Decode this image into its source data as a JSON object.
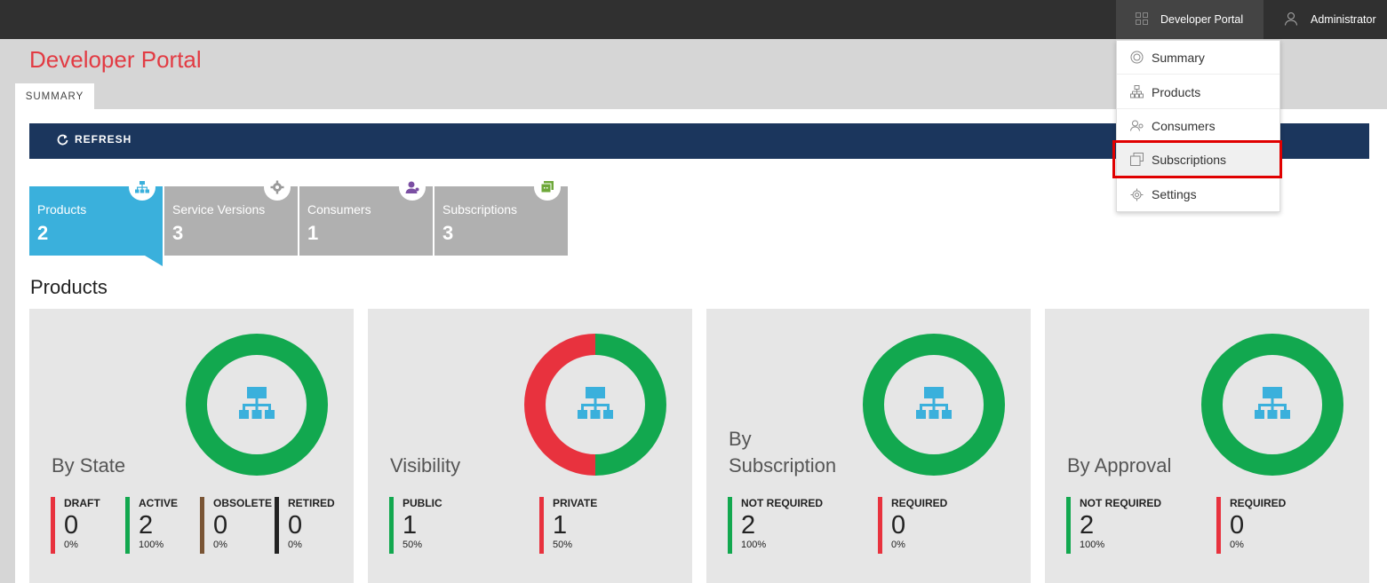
{
  "topbar": {
    "portal_label": "Developer Portal",
    "user_label": "Administrator"
  },
  "page": {
    "title": "Developer Portal",
    "tab": "SUMMARY",
    "refresh_label": "REFRESH",
    "section_title": "Products"
  },
  "tiles": [
    {
      "label": "Products",
      "count": "2",
      "icon": "hierarchy-icon",
      "active": true
    },
    {
      "label": "Service Versions",
      "count": "3",
      "icon": "gear-icon",
      "active": false
    },
    {
      "label": "Consumers",
      "count": "1",
      "icon": "user-icon",
      "active": false
    },
    {
      "label": "Subscriptions",
      "count": "3",
      "icon": "subscriptions-icon",
      "active": false
    }
  ],
  "cards": [
    {
      "title": "By State",
      "legend": [
        {
          "name": "DRAFT",
          "value": "0",
          "pct": "0%",
          "color": "#e8323e"
        },
        {
          "name": "ACTIVE",
          "value": "2",
          "pct": "100%",
          "color": "#12a84f"
        },
        {
          "name": "OBSOLETE",
          "value": "0",
          "pct": "0%",
          "color": "#7a5535"
        },
        {
          "name": "RETIRED",
          "value": "0",
          "pct": "0%",
          "color": "#222222"
        }
      ]
    },
    {
      "title": "Visibility",
      "legend": [
        {
          "name": "PUBLIC",
          "value": "1",
          "pct": "50%",
          "color": "#12a84f"
        },
        {
          "name": "PRIVATE",
          "value": "1",
          "pct": "50%",
          "color": "#e8323e"
        }
      ]
    },
    {
      "title": "By Subscription",
      "legend": [
        {
          "name": "NOT REQUIRED",
          "value": "2",
          "pct": "100%",
          "color": "#12a84f"
        },
        {
          "name": "REQUIRED",
          "value": "0",
          "pct": "0%",
          "color": "#e8323e"
        }
      ]
    },
    {
      "title": "By Approval",
      "legend": [
        {
          "name": "NOT REQUIRED",
          "value": "2",
          "pct": "100%",
          "color": "#12a84f"
        },
        {
          "name": "REQUIRED",
          "value": "0",
          "pct": "0%",
          "color": "#e8323e"
        }
      ]
    }
  ],
  "menu": {
    "items": [
      {
        "label": "Summary",
        "icon": "summary-icon"
      },
      {
        "label": "Products",
        "icon": "hierarchy-icon"
      },
      {
        "label": "Consumers",
        "icon": "users-icon"
      },
      {
        "label": "Subscriptions",
        "icon": "subscriptions-icon",
        "highlighted": true
      },
      {
        "label": "Settings",
        "icon": "gear-icon"
      }
    ]
  },
  "colors": {
    "accent_red": "#e23b43",
    "toolbar_navy": "#1b365d",
    "tile_active": "#3ab0dc",
    "green": "#12a84f",
    "red": "#e8323e"
  }
}
